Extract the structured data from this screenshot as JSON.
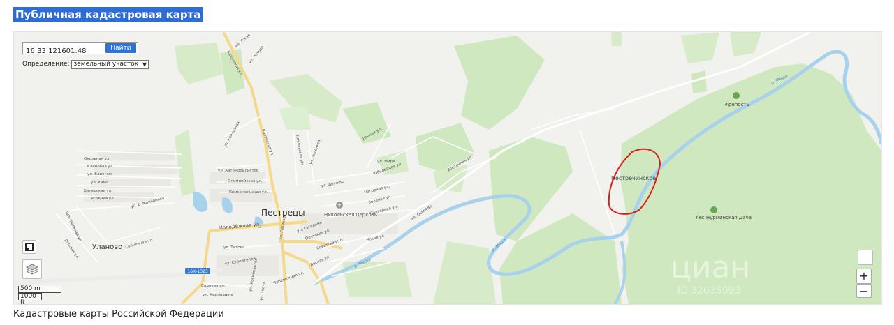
{
  "page": {
    "title": "Публичная кадастровая карта",
    "footer_title": "Кадастровые карты Российской Федерации"
  },
  "search": {
    "value": "16:33:121601:48",
    "button_label": "Найти",
    "definition_label": "Определение:",
    "definition_selected": "земельный участок"
  },
  "map": {
    "zoom_in": "+",
    "zoom_out": "−",
    "scale_metric": "500 m",
    "scale_imperial": "1000 ft",
    "watermark_text": "циан",
    "watermark_id": "ID 32635093",
    "road_badge": "16К-1323",
    "places": {
      "pestretsy": "Пестрецы",
      "ulanovo": "Уланово",
      "pestrechinskoe": "Пестречинское",
      "krepost": "Крепость",
      "les": "лес Нурминская Дача",
      "church": "Никольская церковь",
      "river": "р. Меша"
    },
    "streets": [
      "ул. Тукая",
      "ул. Чехова",
      "Казанская ул.",
      "ул. Колхозная",
      "Казанская ул.",
      "Никольская ул.",
      "ул. Энгельса",
      "Дачная ул.",
      "ул. Мира",
      "Юбилейная ул.",
      "Восточная ул.",
      "ул. Автомобилистов",
      "Олимпийская ул.",
      "Комсомольская ул.",
      "ул. Дружбы",
      "Нагорная ул.",
      "Зелёная ул.",
      "Подгорная ул.",
      "ул. Осипова",
      "Окольная ул.",
      "Кленовая ул.",
      "ул. Блиегам",
      "ул. Умма",
      "Билерская ул.",
      "Ягодная ул.",
      "ул. Е. Манчанова",
      "Центральная ул.",
      "Луговая ул.",
      "Солнечная ул.",
      "Молодёжная ул.",
      "ул. Гагарина",
      "ул. Ганиева",
      "Почтовая ул.",
      "Советская ул.",
      "Новая ул.",
      "ул. Титова",
      "ул. Строителей",
      "Лесная ул.",
      "Набережная ул.",
      "Садовая ул.",
      "ул. Кирпишина",
      "ул. Космонавтов",
      "ул. Ткача"
    ],
    "colors": {
      "background": "#f1f1ee",
      "forest": "#cfe8c0",
      "forest_dark": "#bfe0ad",
      "water": "#a8d2ec",
      "road_main": "#f5d98a",
      "highlight": "#d62020",
      "accent_button": "#2f73d8"
    }
  }
}
